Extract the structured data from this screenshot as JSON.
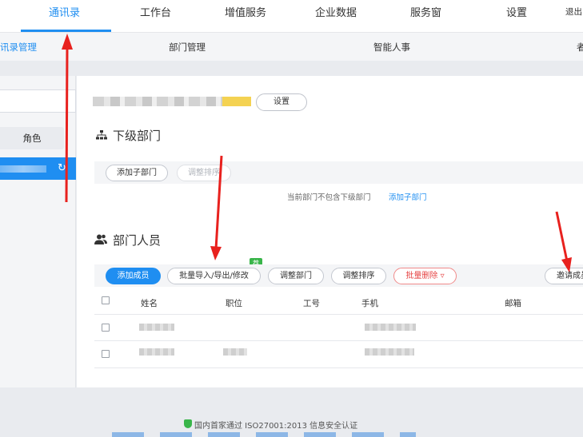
{
  "topnav": {
    "items": [
      "通讯录",
      "工作台",
      "增值服务",
      "企业数据",
      "服务窗",
      "设置",
      "退出"
    ]
  },
  "subnav": {
    "items": [
      "讯录管理",
      "部门管理",
      "智能人事",
      "者"
    ]
  },
  "sidebar": {
    "role_label": "角色",
    "refresh_icon": "refresh-icon"
  },
  "company": {
    "settings_label": "设置"
  },
  "subdept": {
    "title": "下级部门",
    "icon": "org-tree-icon",
    "add_label": "添加子部门",
    "sort_label": "调整排序",
    "empty_text": "当前部门不包含下级部门",
    "empty_link": "添加子部门"
  },
  "members": {
    "title": "部门人员",
    "icon": "users-icon",
    "add_label": "添加成员",
    "batch_label": "批量导入/导出/修改",
    "badge": "荐",
    "adjust_dept_label": "调整部门",
    "sort_label": "调整排序",
    "batch_delete_label": "批量删除",
    "invite_label": "邀请成员",
    "columns": [
      "姓名",
      "职位",
      "工号",
      "手机",
      "邮箱"
    ]
  },
  "footer": {
    "cert_text": "国内首家通过 ISO27001:2013 信息安全认证"
  },
  "colors": {
    "accent": "#1f8ef1",
    "danger": "#e64545",
    "annotation": "#e8211e"
  }
}
